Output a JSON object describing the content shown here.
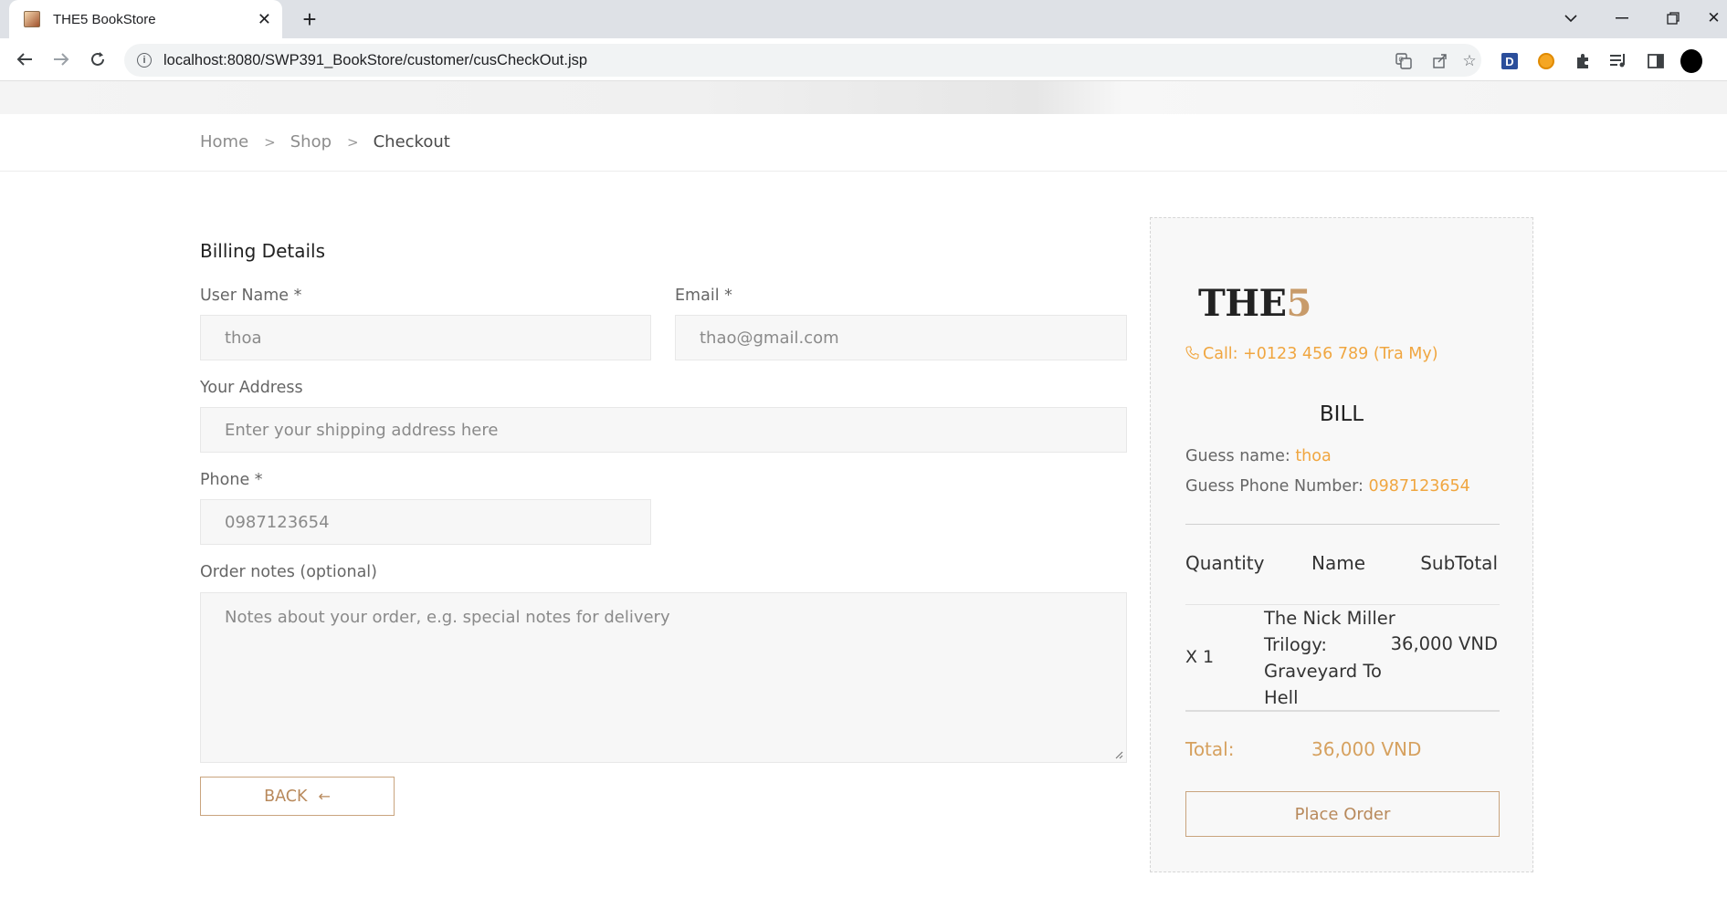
{
  "browser": {
    "tab_title": "THE5 BookStore",
    "url": "localhost:8080/SWP391_BookStore/customer/cusCheckOut.jsp"
  },
  "breadcrumb": {
    "home": "Home",
    "shop": "Shop",
    "current": "Checkout"
  },
  "billing": {
    "title": "Billing Details",
    "username_label": "User Name *",
    "username_value": "thoa",
    "email_label": "Email *",
    "email_value": "thao@gmail.com",
    "address_label": "Your Address",
    "address_placeholder": "Enter your shipping address here",
    "phone_label": "Phone *",
    "phone_value": "0987123654",
    "notes_label": "Order notes (optional)",
    "notes_placeholder": "Notes about your order, e.g. special notes for delivery",
    "back_label": "BACK"
  },
  "bill": {
    "logo_main": "THE",
    "logo_accent": "5",
    "call_text": "Call: +0123 456 789 (Tra My)",
    "title": "BILL",
    "guest_name_label": "Guess name: ",
    "guest_name_value": "thoa",
    "guest_phone_label": "Guess Phone Number: ",
    "guest_phone_value": "0987123654",
    "headers": {
      "quantity": "Quantity",
      "name": "Name",
      "subtotal": "SubTotal"
    },
    "items": [
      {
        "qty": "X 1",
        "name": "The Nick Miller Trilogy: Graveyard To Hell",
        "subtotal": "36,000 VND"
      }
    ],
    "total_label": "Total:",
    "total_value": "36,000 VND",
    "place_order_label": "Place Order"
  },
  "colors": {
    "accent": "#c9a47e",
    "orange": "#f0a640"
  }
}
